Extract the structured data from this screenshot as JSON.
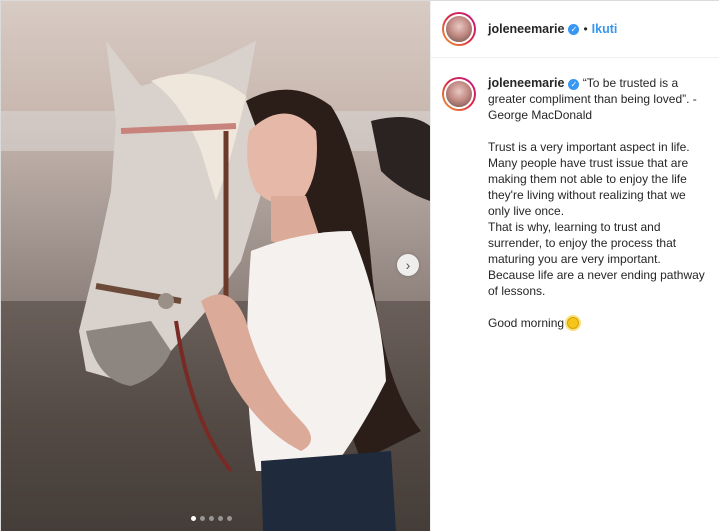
{
  "post": {
    "username": "joleneemarie",
    "follow_label": "Ikuti",
    "separator": "•",
    "caption_quote": "“To be trusted is a greater compliment than being loved”. - George MacDonald",
    "caption_body": "Trust is a very important aspect in life. Many people have trust issue that are making them not able to enjoy the life they're living without realizing that we only live once.\nThat is why, learning to trust and surrender, to enjoy the process that maturing you are very important. Because life are a never ending pathway of lessons.",
    "caption_closing": "Good morning",
    "carousel": {
      "total_slides": 5,
      "active_index": 0
    }
  },
  "icons": {
    "verified": "verified-badge-icon",
    "next": "chevron-right-icon",
    "sun": "sun-emoji-icon"
  },
  "colors": {
    "accent": "#3897f0",
    "text": "#262626",
    "border": "#dbdbdb"
  }
}
